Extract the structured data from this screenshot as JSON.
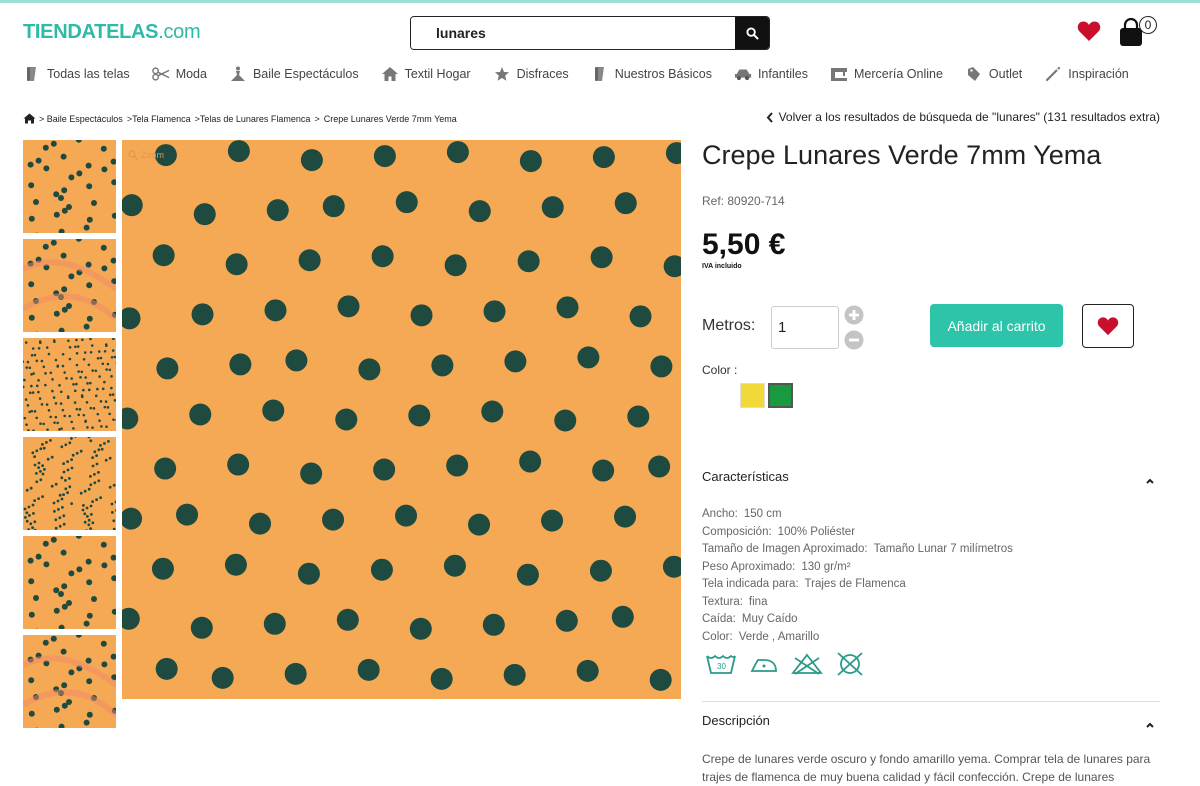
{
  "header": {
    "logo_main": "TIENDATELAS",
    "logo_suffix": ".com",
    "search_value": "lunares",
    "cart_count": "0",
    "colors": {
      "brand": "#2dbaa6",
      "heart": "#c8102e",
      "button": "#2ec4a9"
    }
  },
  "nav": [
    {
      "label": "Todas las telas",
      "icon": "fabric-roll-icon"
    },
    {
      "label": "Moda",
      "icon": "scissors-icon"
    },
    {
      "label": "Baile Espectáculos",
      "icon": "dancer-icon"
    },
    {
      "label": "Textil Hogar",
      "icon": "house-icon"
    },
    {
      "label": "Disfraces",
      "icon": "star-icon"
    },
    {
      "label": "Nuestros Básicos",
      "icon": "fabric-roll-icon"
    },
    {
      "label": "Infantiles",
      "icon": "toy-car-icon"
    },
    {
      "label": "Mercería Online",
      "icon": "sewing-machine-icon"
    },
    {
      "label": "Outlet",
      "icon": "tag-icon"
    },
    {
      "label": "Inspiración",
      "icon": "needle-icon"
    }
  ],
  "breadcrumb": {
    "items": [
      "> Baile Espectáculos",
      ">Tela Flamenca",
      ">Telas de Lunares Flamenca",
      ">",
      "Crepe Lunares Verde 7mm Yema"
    ],
    "back_link": "Volver a los resultados de búsqueda de \"lunares\" (131 resultados extra)"
  },
  "gallery": {
    "zoom_label": "Zoom",
    "base_color": "#f6a955",
    "dot_color": "#1e4a40"
  },
  "product": {
    "title": "Crepe Lunares Verde 7mm Yema",
    "ref": "Ref: 80920-714",
    "price": "5,50 €",
    "tax_note": "IVA incluido",
    "metros_label": "Metros:",
    "quantity": "1",
    "add_to_cart": "Añadir al carrito",
    "color_label": "Color :",
    "color_swatches": [
      "#f2d93a",
      "#1a9a3e"
    ]
  },
  "characteristics": {
    "heading": "Características",
    "rows": [
      {
        "key": "Ancho:",
        "value": "150 cm"
      },
      {
        "key": "Composición:",
        "value": "100% Poliéster"
      },
      {
        "key": "Tamaño de Imagen Aproximado:",
        "value": "Tamaño Lunar 7 milímetros"
      },
      {
        "key": "Peso Aproximado:",
        "value": "130 gr/m²"
      },
      {
        "key": "Tela indicada para:",
        "value": "Trajes de Flamenca"
      },
      {
        "key": "Textura:",
        "value": "fina"
      },
      {
        "key": "Caída:",
        "value": "Muy Caído"
      },
      {
        "key": "Color:",
        "value": "Verde , Amarillo"
      }
    ],
    "care_icons": [
      "wash-30-icon",
      "iron-low-icon",
      "no-bleach-icon",
      "no-tumble-dry-icon"
    ],
    "wash_temp": "30"
  },
  "description": {
    "heading": "Descripción",
    "text": "Crepe de lunares verde oscuro y fondo amarillo yema. Comprar tela de lunares para trajes de flamenca de muy buena calidad y fácil confección. Crepe de lunares"
  }
}
